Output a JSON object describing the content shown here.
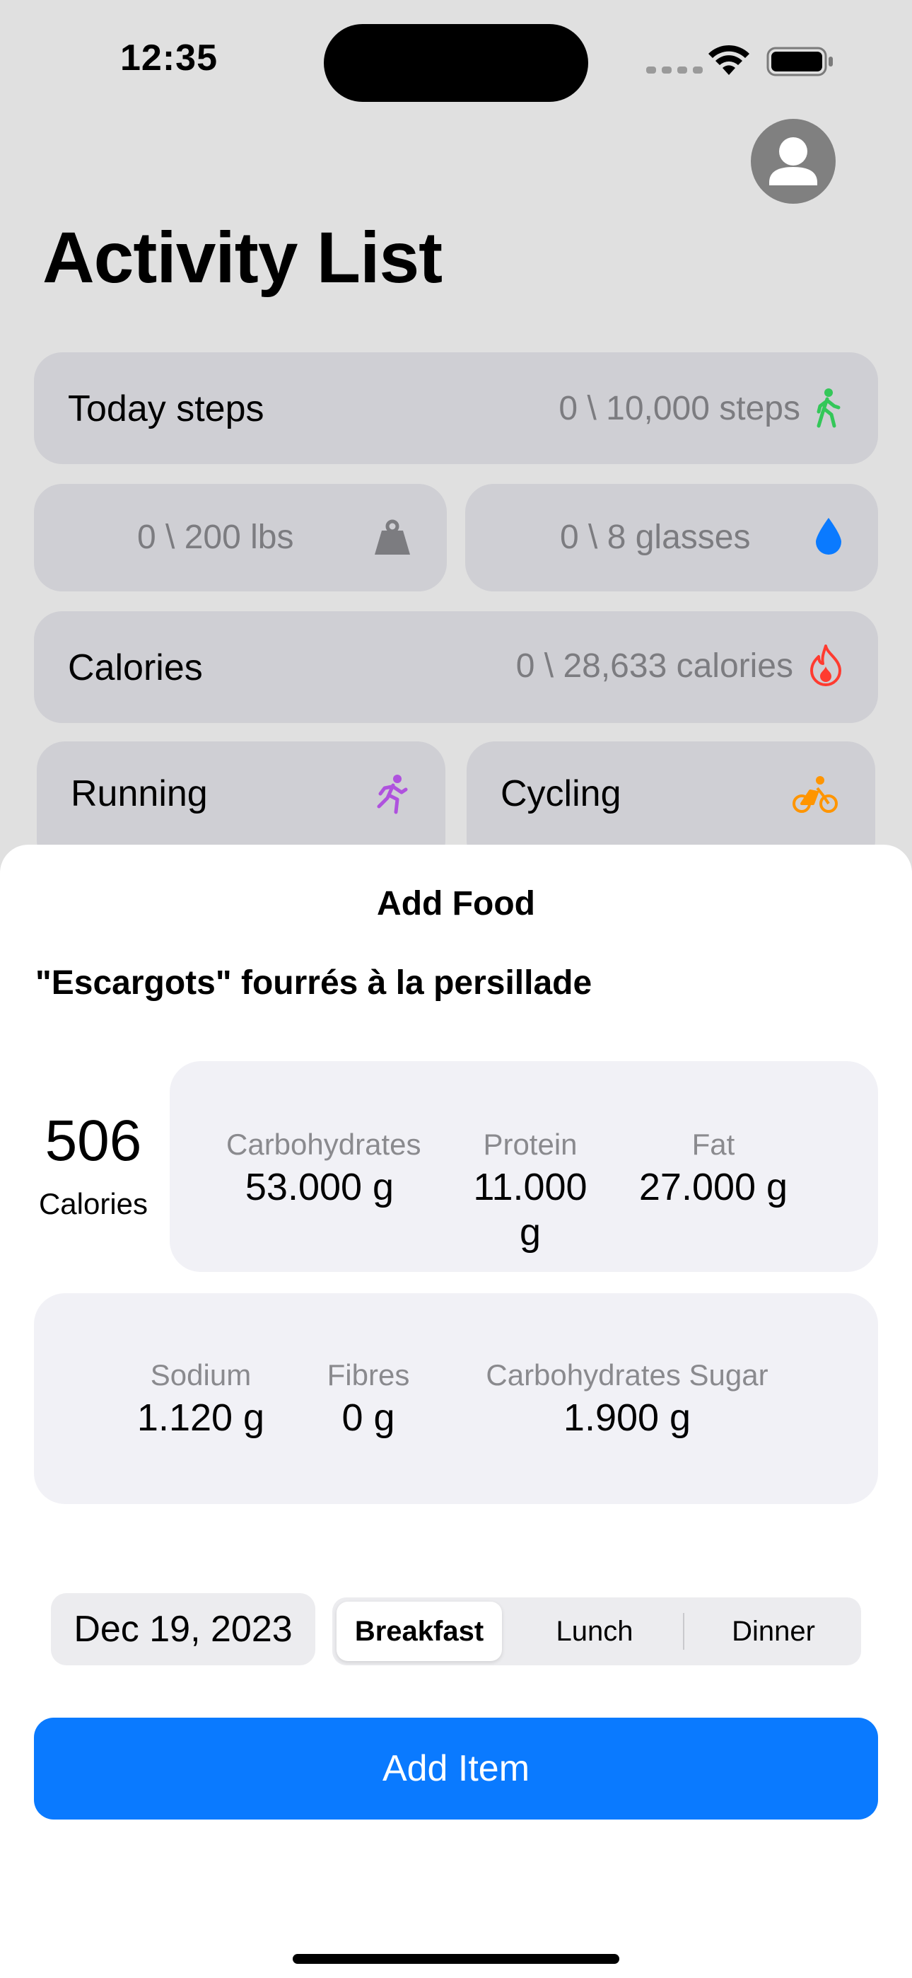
{
  "status_bar": {
    "time": "12:35"
  },
  "header": {
    "title": "Activity List"
  },
  "cards": {
    "steps": {
      "label": "Today steps",
      "value": "0 \\ 10,000 steps",
      "icon": "walking-icon",
      "icon_color": "#34c759"
    },
    "weight": {
      "value": "0 \\ 200 lbs",
      "icon": "weight-icon",
      "icon_color": "#7c7c80"
    },
    "water": {
      "value": "0 \\ 8 glasses",
      "icon": "water-drop-icon",
      "icon_color": "#0a7aff"
    },
    "calories": {
      "label": "Calories",
      "value": "0 \\ 28,633 calories",
      "icon": "flame-icon",
      "icon_color": "#ff3b30"
    },
    "running": {
      "label": "Running",
      "icon": "running-icon",
      "icon_color": "#af52de"
    },
    "cycling": {
      "label": "Cycling",
      "icon": "cycling-icon",
      "icon_color": "#ff9500"
    }
  },
  "sheet": {
    "title": "Add Food",
    "food_name": "\"Escargots\" fourrés à la persillade",
    "calories": {
      "value": "506",
      "label": "Calories"
    },
    "macros": [
      {
        "label": "Carbohydrates",
        "value": "53.000 g"
      },
      {
        "label": "Protein",
        "value": "11.000 g"
      },
      {
        "label": "Fat",
        "value": "27.000 g"
      }
    ],
    "details": [
      {
        "label": "Sodium",
        "value": "1.120 g"
      },
      {
        "label": "Fibres",
        "value": "0 g"
      },
      {
        "label": "Carbohydrates Sugar",
        "value": "1.900 g"
      }
    ],
    "date": "Dec 19, 2023",
    "meals": [
      "Breakfast",
      "Lunch",
      "Dinner"
    ],
    "selected_meal": "Breakfast",
    "add_button": "Add Item"
  },
  "colors": {
    "accent": "#0a7aff",
    "sheet_background": "#ffffff",
    "card_background": "#cfcfd4"
  }
}
